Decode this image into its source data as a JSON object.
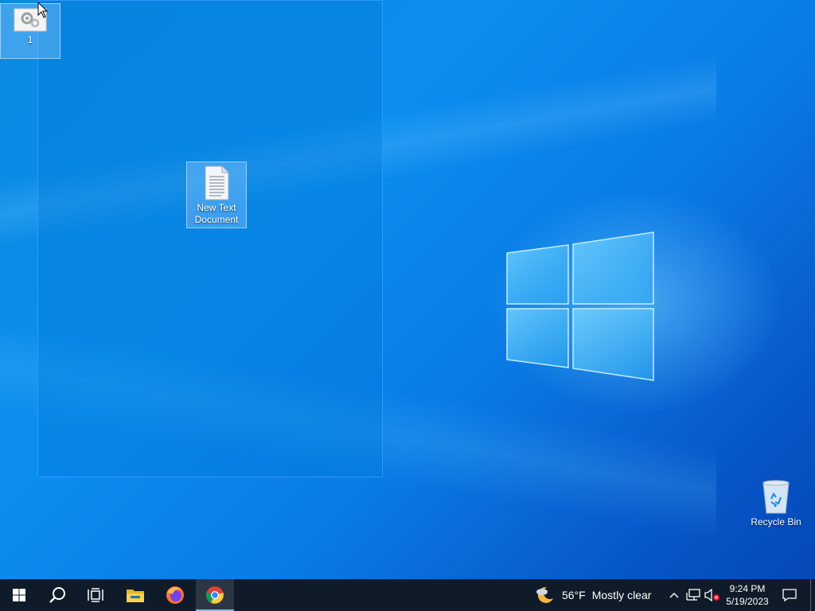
{
  "desktop": {
    "icons": [
      {
        "label": "1"
      },
      {
        "label": "New Text Document"
      },
      {
        "label": "Recycle Bin"
      }
    ]
  },
  "taskbar": {
    "buttons": [
      {
        "name": "start",
        "icon": "windows-start-icon"
      },
      {
        "name": "search",
        "icon": "search-icon"
      },
      {
        "name": "task-view",
        "icon": "task-view-icon"
      },
      {
        "name": "file-explorer",
        "icon": "folder-icon"
      },
      {
        "name": "firefox",
        "icon": "firefox-icon"
      },
      {
        "name": "chrome",
        "icon": "chrome-icon",
        "active": true
      }
    ],
    "weather": {
      "temperature": "56°F",
      "condition": "Mostly clear"
    },
    "clock": {
      "time": "9:24 PM",
      "date": "5/19/2023"
    }
  },
  "colors": {
    "taskbar": "#0f1b28",
    "selection": "#0078d7",
    "accent": "#76b9ed"
  }
}
